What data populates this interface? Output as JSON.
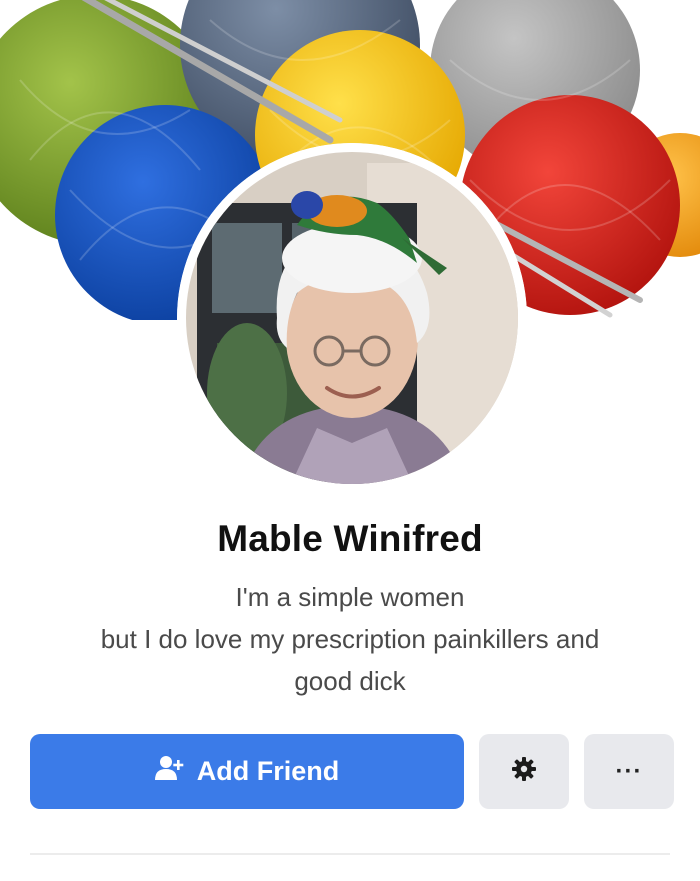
{
  "profile": {
    "name": "Mable Winifred",
    "bio_lines": [
      "I'm a simple women",
      "but I do love my prescription painkillers and",
      "good dick"
    ]
  },
  "actions": {
    "add_friend_label": "Add Friend",
    "add_friend_icon": "add-user-icon",
    "settings_icon": "gear-icon",
    "more_label": "···"
  },
  "colors": {
    "primary_button": "#3b7be8",
    "secondary_button": "#e8e9ed"
  },
  "cover_photo": {
    "description_icon": "yarn-balls-image"
  }
}
